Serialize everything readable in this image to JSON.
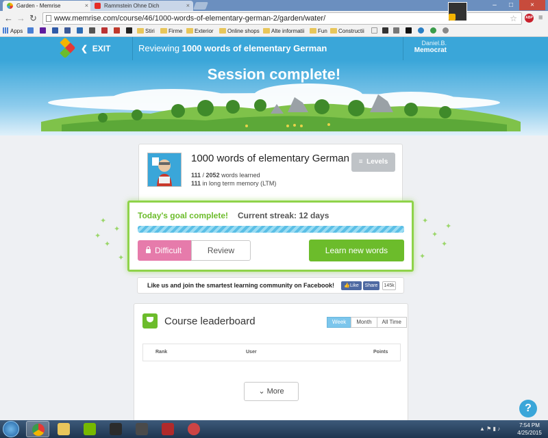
{
  "browser": {
    "tabs": [
      {
        "title": "Garden - Memrise",
        "active": true
      },
      {
        "title": "Rammstein Ohne Dich",
        "active": false
      }
    ],
    "url": "www.memrise.com/course/46/1000-words-of-elementary-german-2/garden/water/",
    "bookmarks": [
      "Apps",
      "Stiri",
      "Firme",
      "Exterior",
      "Online shops",
      "Alte informatii",
      "Fun",
      "Constructii"
    ],
    "abp_label": "ABP"
  },
  "header": {
    "exit_label": "EXIT",
    "reviewing_prefix": "Reviewing",
    "course_name": "1000 words of elementary German",
    "user_name": "Daniel.B.",
    "user_rank": "Memocrat"
  },
  "banner": {
    "title": "Session complete!"
  },
  "course_card": {
    "title": "1000 words of elementary German",
    "words_learned": "111",
    "words_total": "2052",
    "words_learned_suffix": "words learned",
    "ltm_count": "111",
    "ltm_suffix": "in long term memory (LTM)",
    "levels_label": "Levels"
  },
  "goal": {
    "complete_label": "Today's goal complete!",
    "streak_label": "Current streak: 12 days",
    "progress": 1.0,
    "difficult_label": "Difficult",
    "review_label": "Review",
    "learn_label": "Learn new words"
  },
  "facebook": {
    "text": "Like us and join the smartest learning community on Facebook!",
    "like_label": "Like",
    "share_label": "Share",
    "count": "145k"
  },
  "leaderboard": {
    "title": "Course leaderboard",
    "tabs": [
      "Week",
      "Month",
      "All Time"
    ],
    "active_tab": "Week",
    "columns": [
      "Rank",
      "User",
      "Points"
    ],
    "more_label": "More"
  },
  "help": {
    "label": "?"
  },
  "taskbar": {
    "time": "7:54 PM",
    "date": "4/25/2015"
  },
  "colors": {
    "brand_blue": "#3aa6d9",
    "success_green": "#6cbc2b",
    "difficult_pink": "#e67bab"
  }
}
